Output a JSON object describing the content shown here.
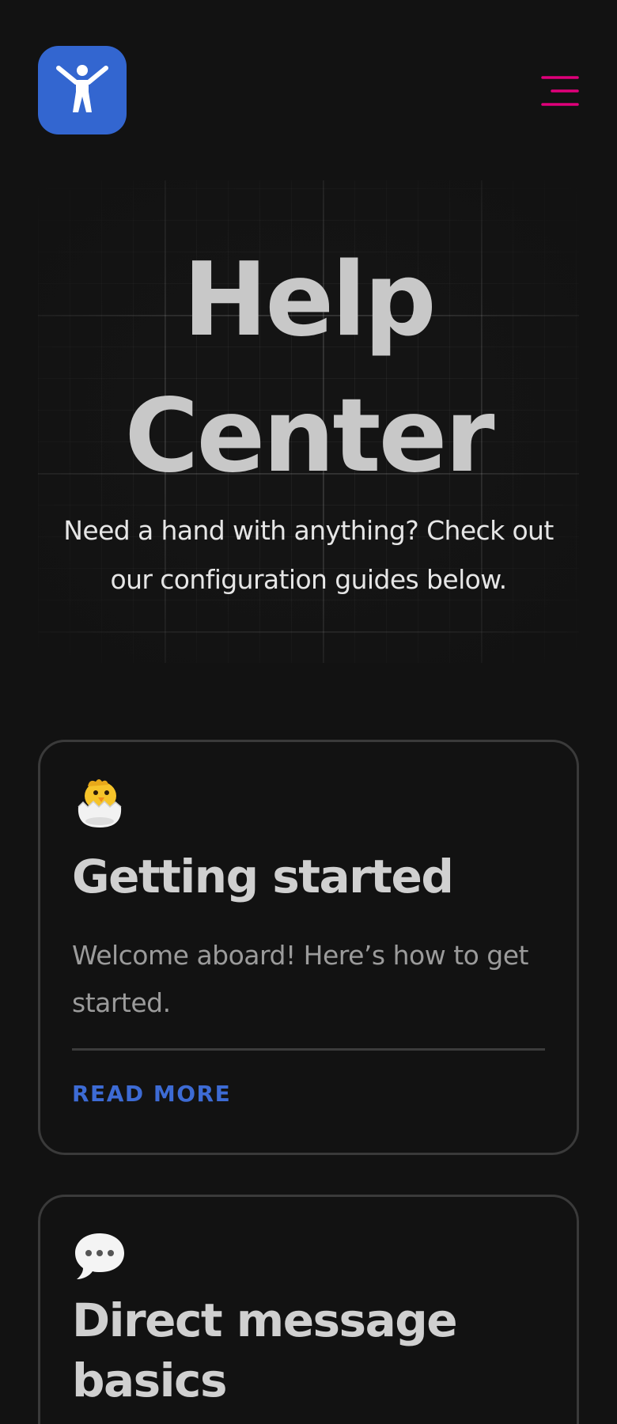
{
  "header": {
    "logo_icon": "accessibility-person-icon",
    "menu_icon": "hamburger-menu-icon",
    "logo_color": "#3366d0",
    "menu_color": "#e0007a"
  },
  "hero": {
    "title_line1": "Help",
    "title_line2": "Center",
    "subtitle": "Need a hand with anything? Check out our configuration guides below."
  },
  "cards": [
    {
      "icon": "hatching-chick-icon",
      "title": "Getting started",
      "description": "Welcome aboard! Here’s how to get started.",
      "link_label": "READ MORE"
    },
    {
      "icon": "speech-bubble-icon",
      "title": "Direct message basics"
    }
  ],
  "colors": {
    "background": "#121212",
    "accent_link": "#3d6bd4",
    "card_border": "#3a3a3a"
  }
}
